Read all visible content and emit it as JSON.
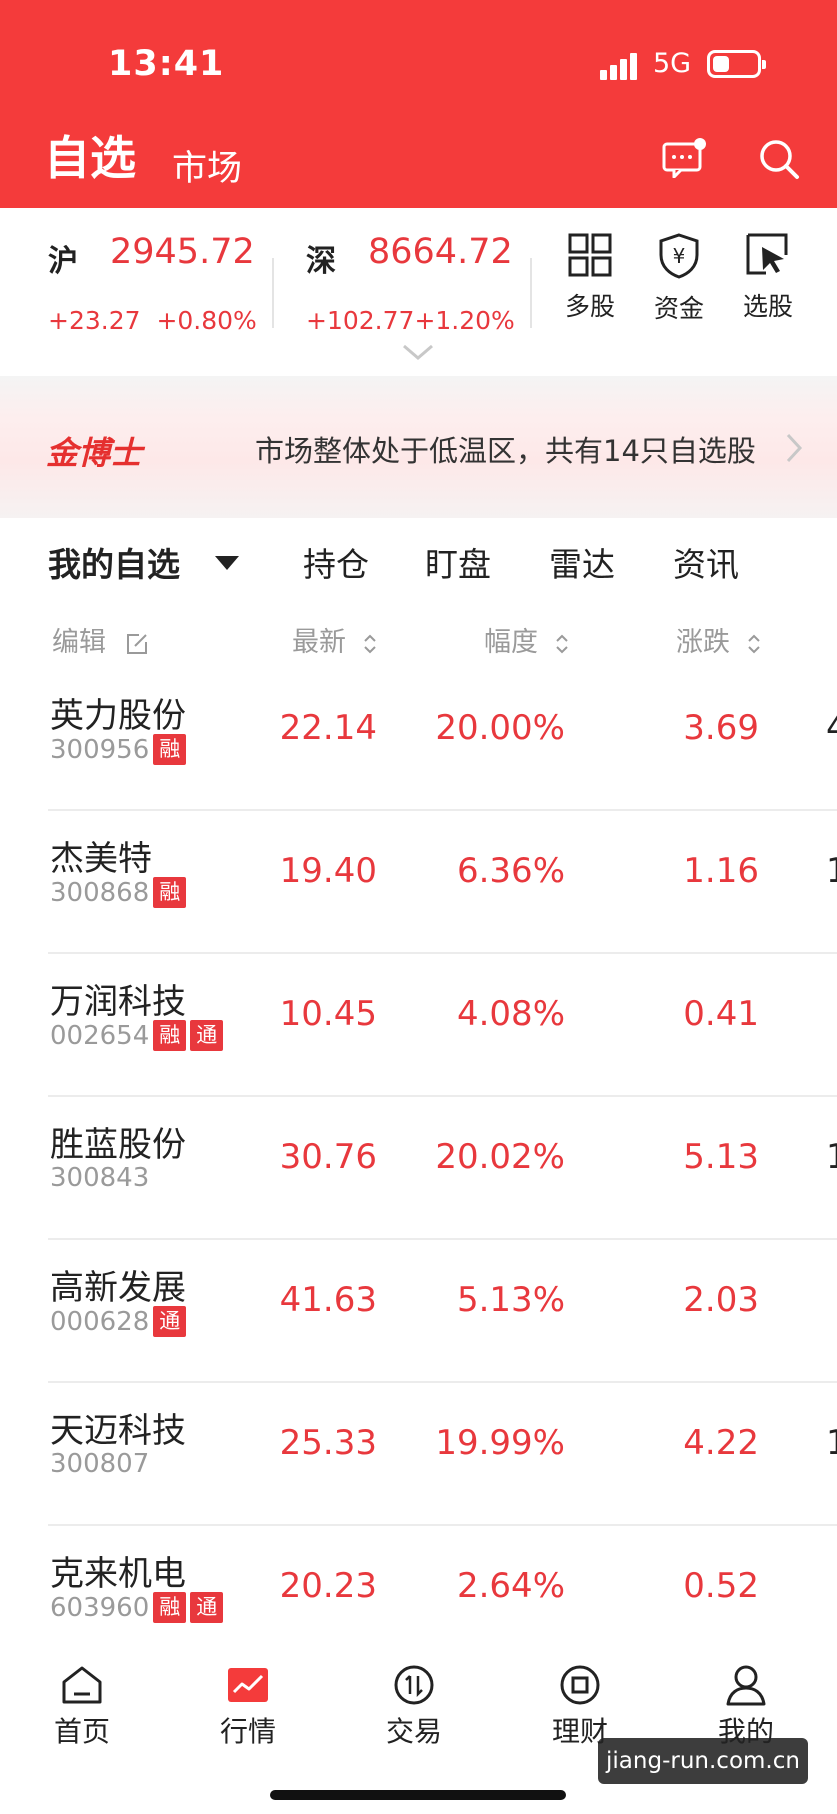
{
  "status_bar": {
    "time": "13:41",
    "network": "5G"
  },
  "header": {
    "tab_active": "自选",
    "tab_other": "市场"
  },
  "indices": [
    {
      "name": "沪",
      "value": "2945.72",
      "change": "+23.27",
      "pct": "+0.80%"
    },
    {
      "name": "深",
      "value": "8664.72",
      "change": "+102.77",
      "pct": "+1.20%"
    }
  ],
  "quick_actions": [
    {
      "label": "多股",
      "icon": "grid-icon"
    },
    {
      "label": "资金",
      "icon": "shield-yen-icon"
    },
    {
      "label": "选股",
      "icon": "cursor-select-icon"
    }
  ],
  "banner": {
    "brand": "金博士",
    "text": "市场整体处于低温区，共有14只自选股"
  },
  "tabs": [
    "我的自选",
    "持仓",
    "盯盘",
    "雷达",
    "资讯"
  ],
  "columns": {
    "edit": "编辑",
    "latest": "最新",
    "range": "幅度",
    "change": "涨跌"
  },
  "stocks": [
    {
      "name": "英力股份",
      "code": "300956",
      "tags": [
        "融"
      ],
      "price": "22.14",
      "pct": "20.00%",
      "change": "3.69",
      "overflow": "4"
    },
    {
      "name": "杰美特",
      "code": "300868",
      "tags": [
        "融"
      ],
      "price": "19.40",
      "pct": "6.36%",
      "change": "1.16",
      "overflow": "1"
    },
    {
      "name": "万润科技",
      "code": "002654",
      "tags": [
        "融",
        "通"
      ],
      "price": "10.45",
      "pct": "4.08%",
      "change": "0.41",
      "overflow": ""
    },
    {
      "name": "胜蓝股份",
      "code": "300843",
      "tags": [],
      "price": "30.76",
      "pct": "20.02%",
      "change": "5.13",
      "overflow": "1"
    },
    {
      "name": "高新发展",
      "code": "000628",
      "tags": [
        "通"
      ],
      "price": "41.63",
      "pct": "5.13%",
      "change": "2.03",
      "overflow": ""
    },
    {
      "name": "天迈科技",
      "code": "300807",
      "tags": [],
      "price": "25.33",
      "pct": "19.99%",
      "change": "4.22",
      "overflow": "1"
    },
    {
      "name": "克来机电",
      "code": "603960",
      "tags": [
        "融",
        "通"
      ],
      "price": "20.23",
      "pct": "2.64%",
      "change": "0.52",
      "overflow": ""
    }
  ],
  "bottom_nav": [
    {
      "label": "首页",
      "icon": "home-icon"
    },
    {
      "label": "行情",
      "icon": "market-chart-icon"
    },
    {
      "label": "交易",
      "icon": "trade-icon"
    },
    {
      "label": "理财",
      "icon": "wealth-icon"
    },
    {
      "label": "我的",
      "icon": "profile-icon"
    }
  ],
  "watermark": "jiang-run.com.cn",
  "colors": {
    "brand_red": "#f43b3b",
    "up_red": "#e8383d",
    "muted_gray": "#9a9a9a"
  }
}
